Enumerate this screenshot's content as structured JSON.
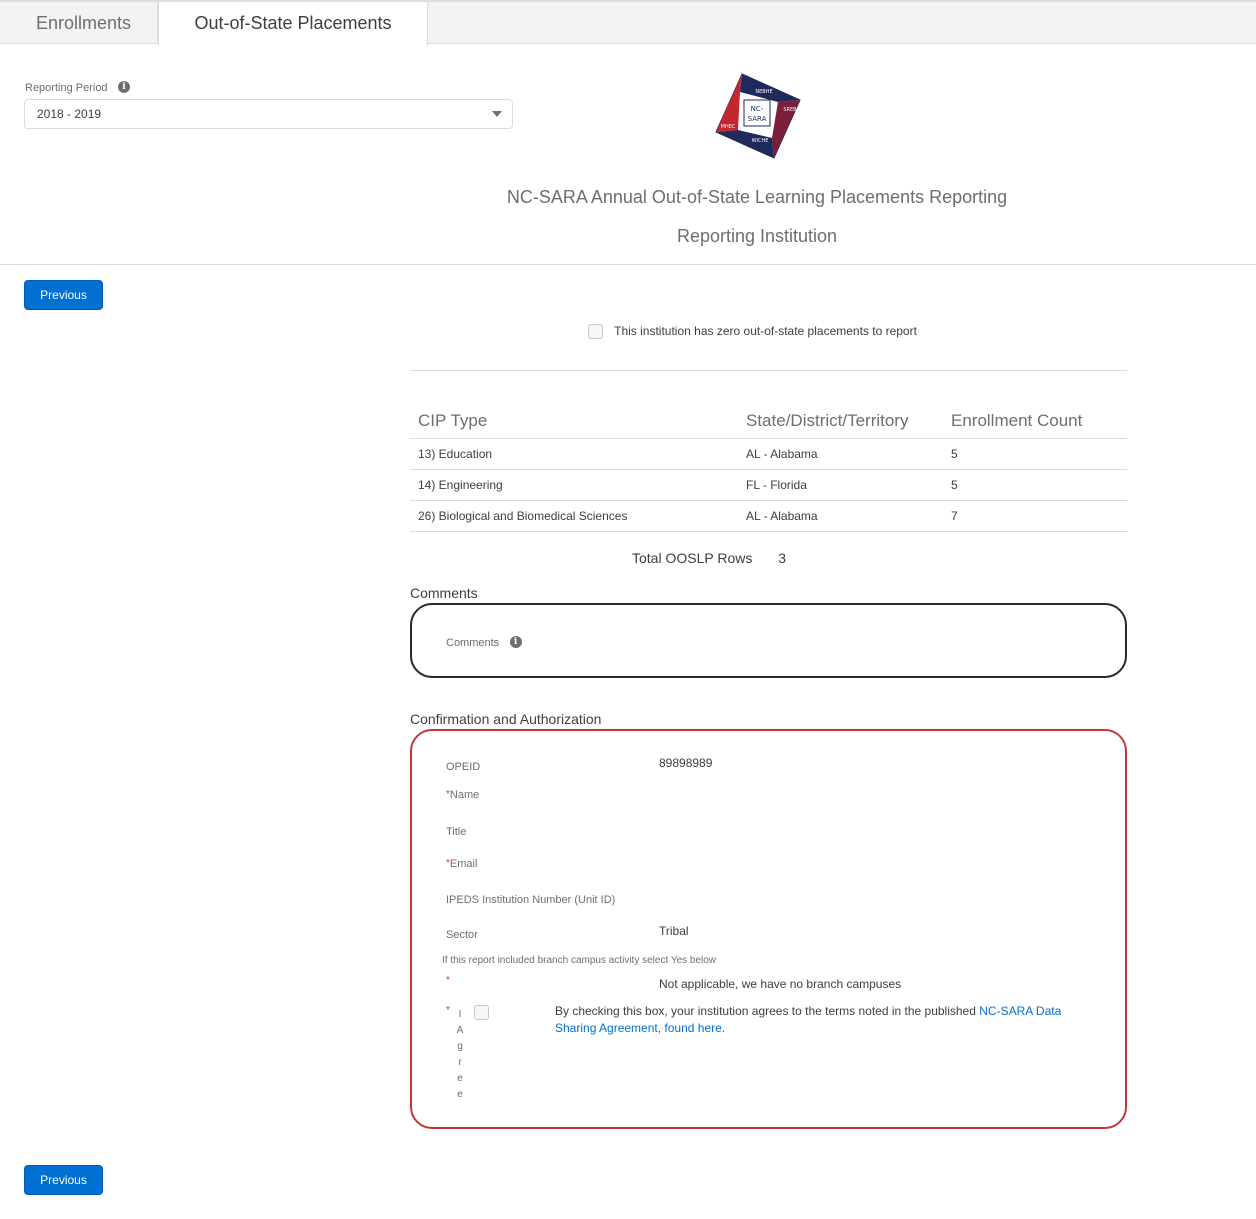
{
  "tabs": [
    {
      "label": "Enrollments"
    },
    {
      "label": "Out-of-State Placements"
    }
  ],
  "reporting_period": {
    "label": "Reporting Period",
    "selected": "2018 - 2019"
  },
  "logo": {
    "top_text": "NEBHE",
    "left_text": "MHEC",
    "right_text": "SREB",
    "bottom_text": "WICHE",
    "center_line1": "NC-",
    "center_line2": "SARA",
    "colors": {
      "navy": "#1f2a5c",
      "red": "#c1272d",
      "maroon": "#7b1e3a",
      "white": "#ffffff"
    }
  },
  "header": {
    "title": "NC-SARA Annual Out-of-State Learning Placements Reporting",
    "subtitle": "Reporting Institution"
  },
  "buttons": {
    "previous_label": "Previous"
  },
  "zero_placements": {
    "label": "This institution has zero out-of-state placements to report",
    "checked": false
  },
  "placements_table": {
    "headers": [
      "CIP Type",
      "State/District/Territory",
      "Enrollment Count"
    ],
    "rows": [
      [
        "13) Education",
        "AL - Alabama",
        "5"
      ],
      [
        "14) Engineering",
        "FL - Florida",
        "5"
      ],
      [
        "26) Biological and Biomedical Sciences",
        "AL - Alabama",
        "7"
      ]
    ]
  },
  "totals": {
    "label": "Total OOSLP Rows",
    "value": "3"
  },
  "comments": {
    "section_title": "Comments",
    "field_label": "Comments"
  },
  "confirmation": {
    "section_title": "Confirmation and Authorization",
    "required_marker": "*",
    "opeid_label": "OPEID",
    "opeid_value": "89898989",
    "name_label": "Name",
    "title_label": "Title",
    "email_label": "Email",
    "ipeds_label": "IPEDS Institution Number (Unit ID)",
    "sector_label": "Sector",
    "sector_value": "Tribal",
    "branch_note": "If this report included branch campus activity select Yes below",
    "branch_value": "Not applicable, we have no branch campuses",
    "agree_vertical_label": "I Agree",
    "agree_text": "By checking this box, your institution agrees to the terms noted in the published ",
    "agree_link": "NC-SARA Data Sharing Agreement, found here."
  },
  "colors": {
    "brand_blue": "#0070d2",
    "error_red": "#c23934"
  }
}
